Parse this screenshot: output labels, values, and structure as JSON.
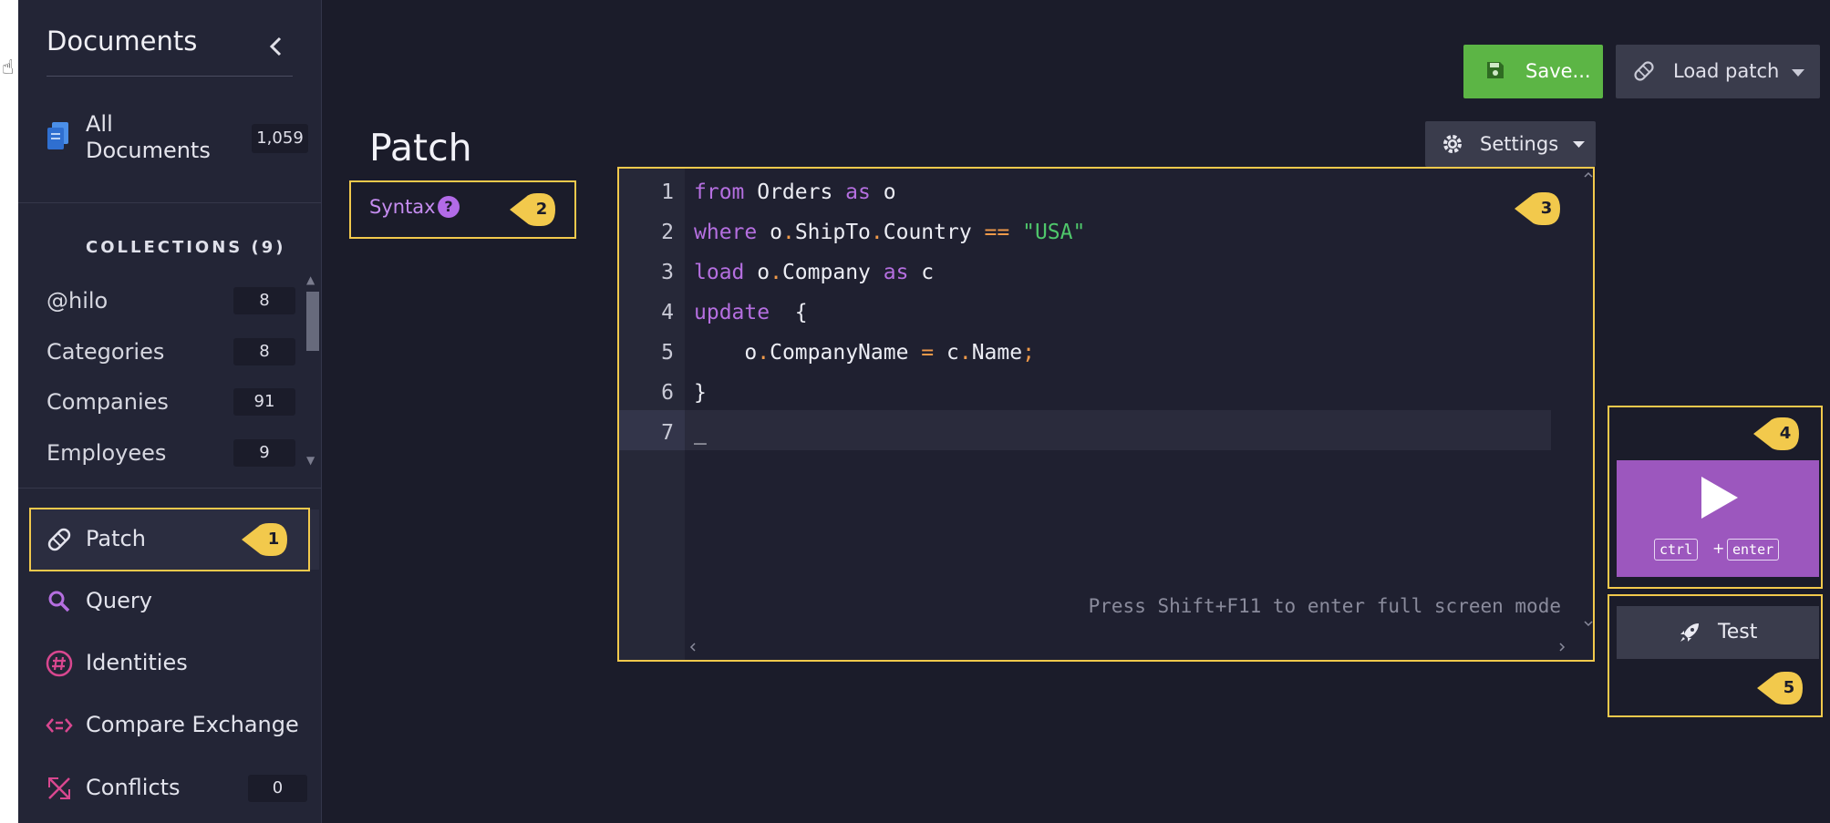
{
  "sidebar": {
    "title": "Documents",
    "all_documents": {
      "label": "All Documents",
      "count": "1,059"
    },
    "collections_header": "COLLECTIONS (9)",
    "collections": [
      {
        "label": "@hilo",
        "count": "8"
      },
      {
        "label": "Categories",
        "count": "8"
      },
      {
        "label": "Companies",
        "count": "91"
      },
      {
        "label": "Employees",
        "count": "9"
      }
    ],
    "nav": [
      {
        "label": "Patch"
      },
      {
        "label": "Query"
      },
      {
        "label": "Identities"
      },
      {
        "label": "Compare Exchange"
      },
      {
        "label": "Conflicts",
        "count": "0"
      }
    ]
  },
  "toolbar": {
    "save_label": "Save...",
    "load_patch_label": "Load patch",
    "settings_label": "Settings"
  },
  "main": {
    "title": "Patch",
    "syntax_label": "Syntax",
    "help_glyph": "?"
  },
  "editor": {
    "line_numbers": [
      "1",
      "2",
      "3",
      "4",
      "5",
      "6",
      "7"
    ],
    "lines": [
      [
        {
          "t": "from",
          "c": "kw"
        },
        {
          "t": " Orders ",
          "c": ""
        },
        {
          "t": "as",
          "c": "kw"
        },
        {
          "t": " o",
          "c": ""
        }
      ],
      [
        {
          "t": "where",
          "c": "kw"
        },
        {
          "t": " o",
          "c": ""
        },
        {
          "t": ".",
          "c": "op"
        },
        {
          "t": "ShipTo",
          "c": ""
        },
        {
          "t": ".",
          "c": "op"
        },
        {
          "t": "Country ",
          "c": ""
        },
        {
          "t": "==",
          "c": "op"
        },
        {
          "t": " ",
          "c": ""
        },
        {
          "t": "\"USA\"",
          "c": "str"
        }
      ],
      [
        {
          "t": "load",
          "c": "kw"
        },
        {
          "t": " o",
          "c": ""
        },
        {
          "t": ".",
          "c": "op"
        },
        {
          "t": "Company ",
          "c": ""
        },
        {
          "t": "as",
          "c": "kw"
        },
        {
          "t": " c",
          "c": ""
        }
      ],
      [
        {
          "t": "update",
          "c": "kw"
        },
        {
          "t": "  {",
          "c": ""
        }
      ],
      [
        {
          "t": "    o",
          "c": ""
        },
        {
          "t": ".",
          "c": "op"
        },
        {
          "t": "CompanyName ",
          "c": ""
        },
        {
          "t": "=",
          "c": "op"
        },
        {
          "t": " c",
          "c": ""
        },
        {
          "t": ".",
          "c": "op"
        },
        {
          "t": "Name",
          "c": ""
        },
        {
          "t": ";",
          "c": "op"
        }
      ],
      [
        {
          "t": "}",
          "c": ""
        }
      ],
      [
        {
          "t": "_",
          "c": ""
        }
      ]
    ],
    "fullscreen_hint": "Press Shift+F11 to enter full screen mode"
  },
  "run": {
    "key1": "ctrl",
    "plus": "+",
    "key2": "enter"
  },
  "test_label": "Test",
  "callouts": [
    "1",
    "2",
    "3",
    "4",
    "5"
  ],
  "colors": {
    "background": "#1b1c2a",
    "sidebar": "#232536",
    "accent_purple": "#9c57be",
    "save_green": "#5cb545",
    "highlight_yellow": "#f2c94c"
  }
}
